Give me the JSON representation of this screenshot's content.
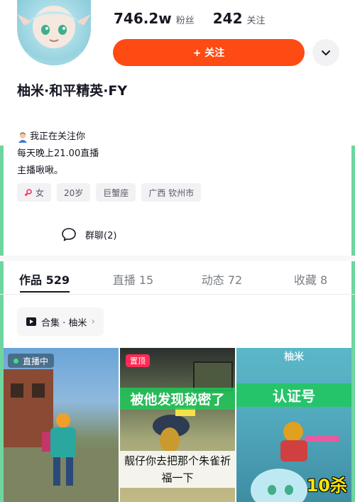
{
  "profile": {
    "followers_count": "746.2w",
    "followers_label": "粉丝",
    "following_count": "242",
    "following_label": "关注",
    "follow_button_label": "+ 关注",
    "nickname": "柚米·和平精英·FY"
  },
  "bio": {
    "lines": [
      "我正在关注你",
      "每天晚上21.00直播",
      "主播啾啾。"
    ]
  },
  "tags": [
    "女",
    "20岁",
    "巨蟹座",
    "广西 钦州市"
  ],
  "group_chat": {
    "label": "群聊(2)"
  },
  "tabs": [
    {
      "label": "作品 529",
      "active": true
    },
    {
      "label": "直播 15",
      "active": false
    },
    {
      "label": "动态 72",
      "active": false
    },
    {
      "label": "收藏 8",
      "active": false
    }
  ],
  "collection": {
    "label": "合集 · 柚米"
  },
  "videos": [
    {
      "badge": "直播中"
    },
    {
      "badge": "置顶",
      "caption_top": "被他发现秘密了",
      "caption_bottom": "靓仔你去把那个朱雀祈福一下"
    },
    {
      "caption_top": "认证号",
      "caption_bottom": "10杀",
      "watermark": "柚米"
    }
  ],
  "colors": {
    "accent": "#fe4a13",
    "frame": "#6fd59e"
  }
}
